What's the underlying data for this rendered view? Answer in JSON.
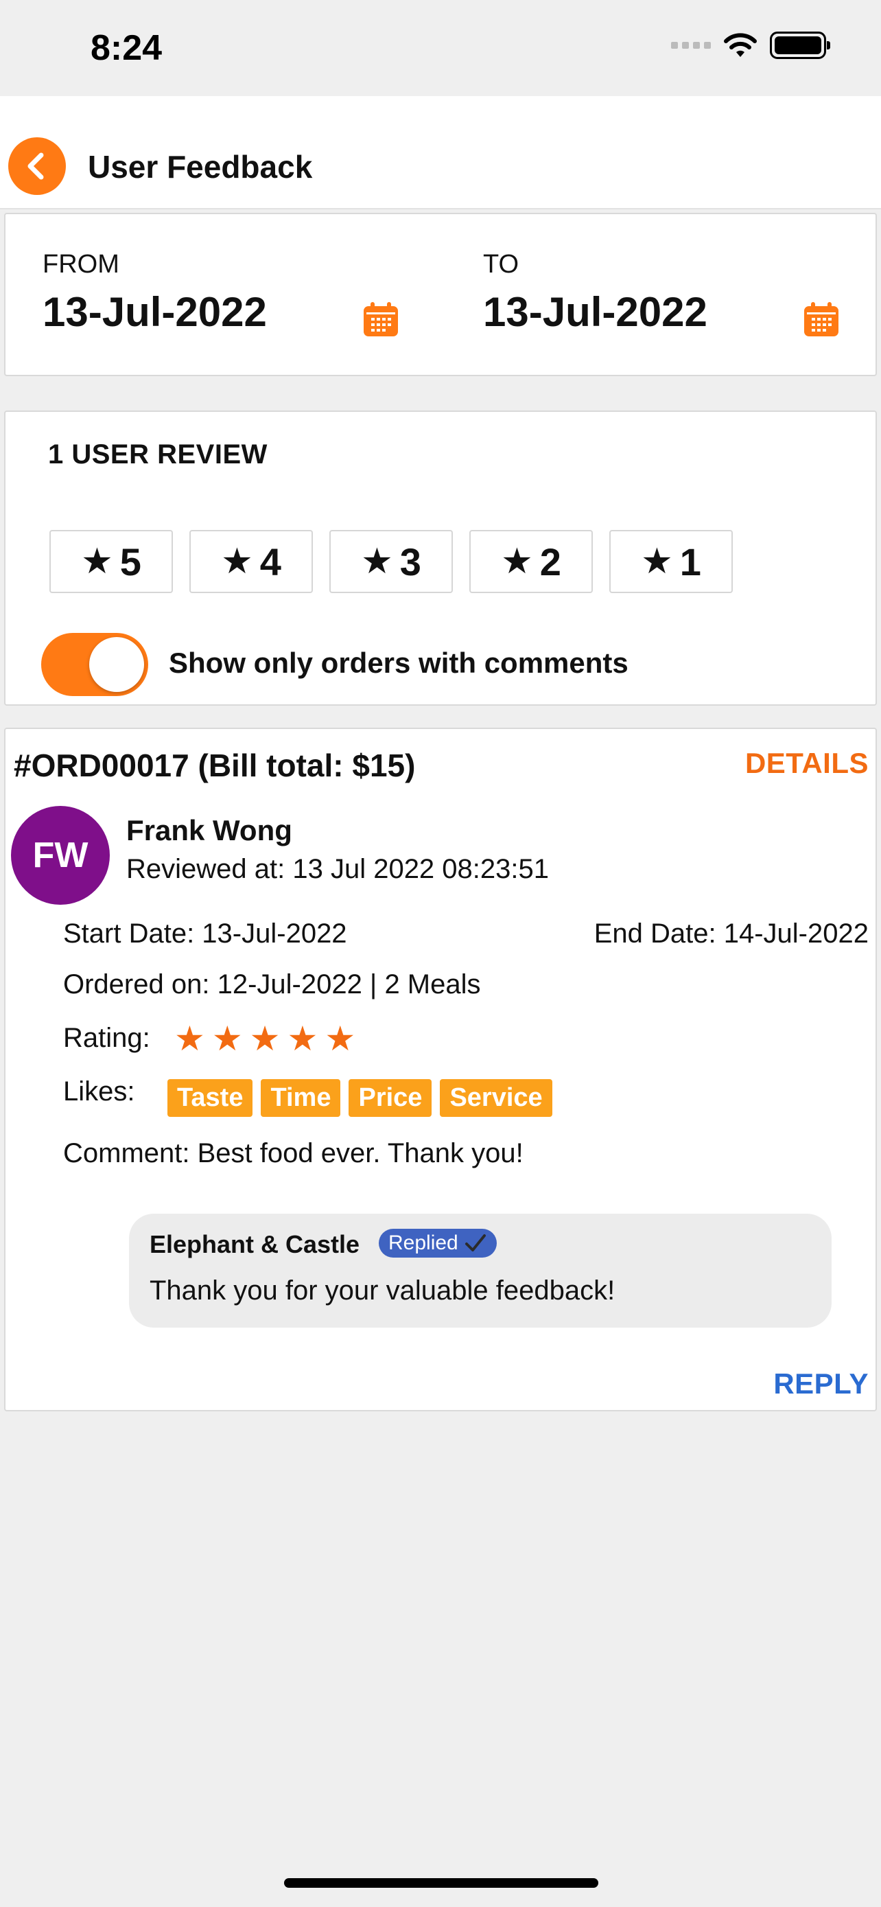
{
  "status_bar": {
    "time": "8:24"
  },
  "nav": {
    "title": "User Feedback",
    "back_icon": "chevron-left-icon"
  },
  "date_range": {
    "from_label": "FROM",
    "from_value": "13-Jul-2022",
    "to_label": "TO",
    "to_value": "13-Jul-2022"
  },
  "reviews": {
    "count_label": "1 USER REVIEW",
    "star_filters": [
      "5",
      "4",
      "3",
      "2",
      "1"
    ],
    "comments_toggle_label": "Show only orders with comments",
    "comments_toggle_on": true
  },
  "order": {
    "title": "#ORD00017 (Bill total: $15)",
    "details_label": "DETAILS",
    "avatar_initials": "FW",
    "reviewer_name": "Frank Wong",
    "reviewed_at": "Reviewed at: 13 Jul 2022 08:23:51",
    "start_date": "Start Date: 13-Jul-2022",
    "end_date": "End Date: 14-Jul-2022",
    "ordered_on": "Ordered on: 12-Jul-2022 | 2 Meals",
    "rating_label": "Rating:",
    "rating_value": 5,
    "likes_label": "Likes:",
    "likes": [
      "Taste",
      "Time",
      "Price",
      "Service"
    ],
    "comment": "Comment: Best food ever. Thank you!",
    "reply": {
      "merchant": "Elephant & Castle",
      "badge": "Replied",
      "text": "Thank you for your valuable feedback!"
    },
    "reply_label": "REPLY"
  },
  "colors": {
    "accent_orange": "#ff7a14",
    "like_chip": "#fba11b",
    "avatar_purple": "#7f0f8a",
    "link_blue": "#2a6bd1",
    "badge_blue": "#3f63c1"
  }
}
